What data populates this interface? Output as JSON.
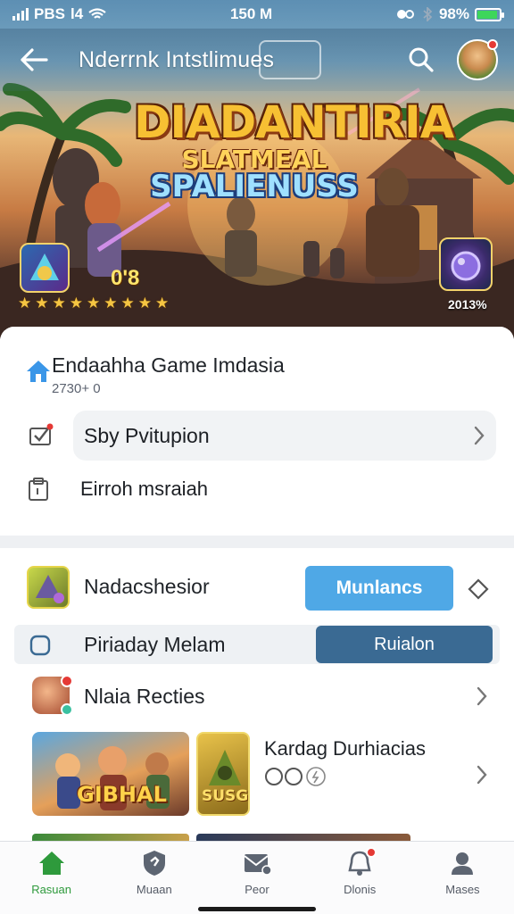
{
  "status_bar": {
    "carrier": "PBS",
    "network": "l4",
    "time": "150 M",
    "battery": "98%"
  },
  "app_bar": {
    "title": "Nderrnk Intstlimues"
  },
  "hero": {
    "logo_line1": "DIADANTIRIA",
    "logo_line2": "SLATMEAL",
    "logo_line3": "SPALIENUSS",
    "rating": "0'8",
    "stars": [
      "★",
      "★",
      "★",
      "★",
      "★",
      "★",
      "★",
      "★",
      "★"
    ],
    "percent": "2013%"
  },
  "menu": {
    "home_title": "Endaahha Game Imdasia",
    "home_sub": "2730+ 0",
    "row2": "Sby Pvitupion",
    "row3": "Eirroh msraiah"
  },
  "list": {
    "item1_label": "Nadacshesior",
    "item1_button": "Munlancs",
    "item2_label": "Piriaday Melam",
    "item2_button": "Ruialon",
    "item3_label": "Nlaia Recties",
    "item4_label": "Kardag Durhiacias",
    "thumb1_label": "GIBHAL",
    "thumb2_label": "SUSG"
  },
  "bottom_nav": [
    {
      "label": "Rasuan",
      "icon": "home-icon"
    },
    {
      "label": "Muaan",
      "icon": "shield-icon"
    },
    {
      "label": "Peor",
      "icon": "mail-icon"
    },
    {
      "label": "Dlonis",
      "icon": "bell-icon"
    },
    {
      "label": "Mases",
      "icon": "profile-icon"
    }
  ],
  "colors": {
    "primary_blue": "#4fa8e6",
    "dark_blue": "#3a6a93",
    "active_green": "#2e9a3c"
  }
}
